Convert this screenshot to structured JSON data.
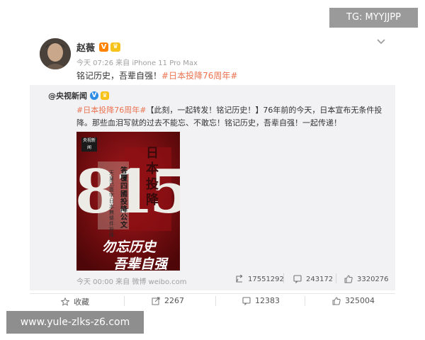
{
  "watermarks": {
    "top_right": "TG: MYYJJPP",
    "bottom_left": "www.yule-zlks-z6.com"
  },
  "post": {
    "author": "赵薇",
    "meta": "今天 07:26 来自 iPhone 11 Pro Max",
    "text_prefix": "铭记历史，吾辈自强！",
    "hashtag": "#日本投降76周年#"
  },
  "repost": {
    "author": "@央视新闻",
    "hashtag": "#日本投降76周年#",
    "text": "【此刻，一起转发！铭记历史！】76年前的今天，日本宣布无条件投降。那些血泪写就的过去不能忘、不敢忘！铭记历史，吾辈自强！一起传递！",
    "poster": {
      "logo": "央视新闻",
      "number": "815",
      "vertical_text": "日本投降",
      "headline": "答覆四國投降公文",
      "subline": "天皇已簽字 日本無條件投降",
      "slogan_line1": "勿忘历史",
      "slogan_line2": "吾辈自强"
    },
    "meta": "今天 00:00 来自 微博 weibo.com",
    "stats": {
      "reposts": "17551292",
      "comments": "243172",
      "likes": "3320276"
    }
  },
  "actions": {
    "favorite": "收藏",
    "repost": "2267",
    "comment": "12383",
    "like": "325004"
  },
  "colors": {
    "link": "#eb7350",
    "repost_bg": "#f2f2f5",
    "poster_red": "#7e0e11",
    "verified_orange": "#ff8200",
    "verified_blue": "#2e8ee6"
  }
}
